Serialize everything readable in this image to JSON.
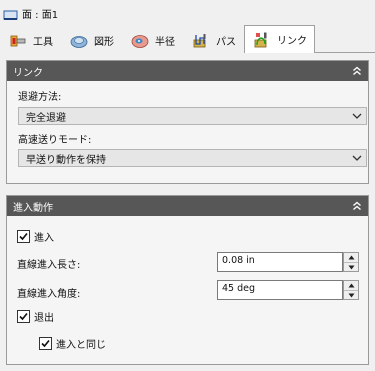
{
  "header": {
    "title": "面 : 面1"
  },
  "tabs": [
    {
      "label": "工具",
      "icon": "tool-icon"
    },
    {
      "label": "図形",
      "icon": "shape-icon"
    },
    {
      "label": "半径",
      "icon": "radius-icon"
    },
    {
      "label": "パス",
      "icon": "path-icon"
    },
    {
      "label": "リンク",
      "icon": "link-icon",
      "active": true
    }
  ],
  "link_panel": {
    "title": "リンク",
    "retract_label": "退避方法:",
    "retract_value": "完全退避",
    "rapid_label": "高速送りモード:",
    "rapid_value": "早送り動作を保持"
  },
  "approach_panel": {
    "title": "進入動作",
    "approach_check_label": "進入",
    "approach_checked": true,
    "linear_length_label": "直線進入長さ:",
    "linear_length_value": "0.08 in",
    "linear_angle_label": "直線進入角度:",
    "linear_angle_value": "45 deg",
    "exit_check_label": "退出",
    "exit_checked": true,
    "same_as_approach_label": "進入と同じ",
    "same_as_approach_checked": true
  },
  "colors": {
    "panel_header": "#575757",
    "tab_active_bg": "#ffffff",
    "window_bg": "#f0f0f0"
  }
}
